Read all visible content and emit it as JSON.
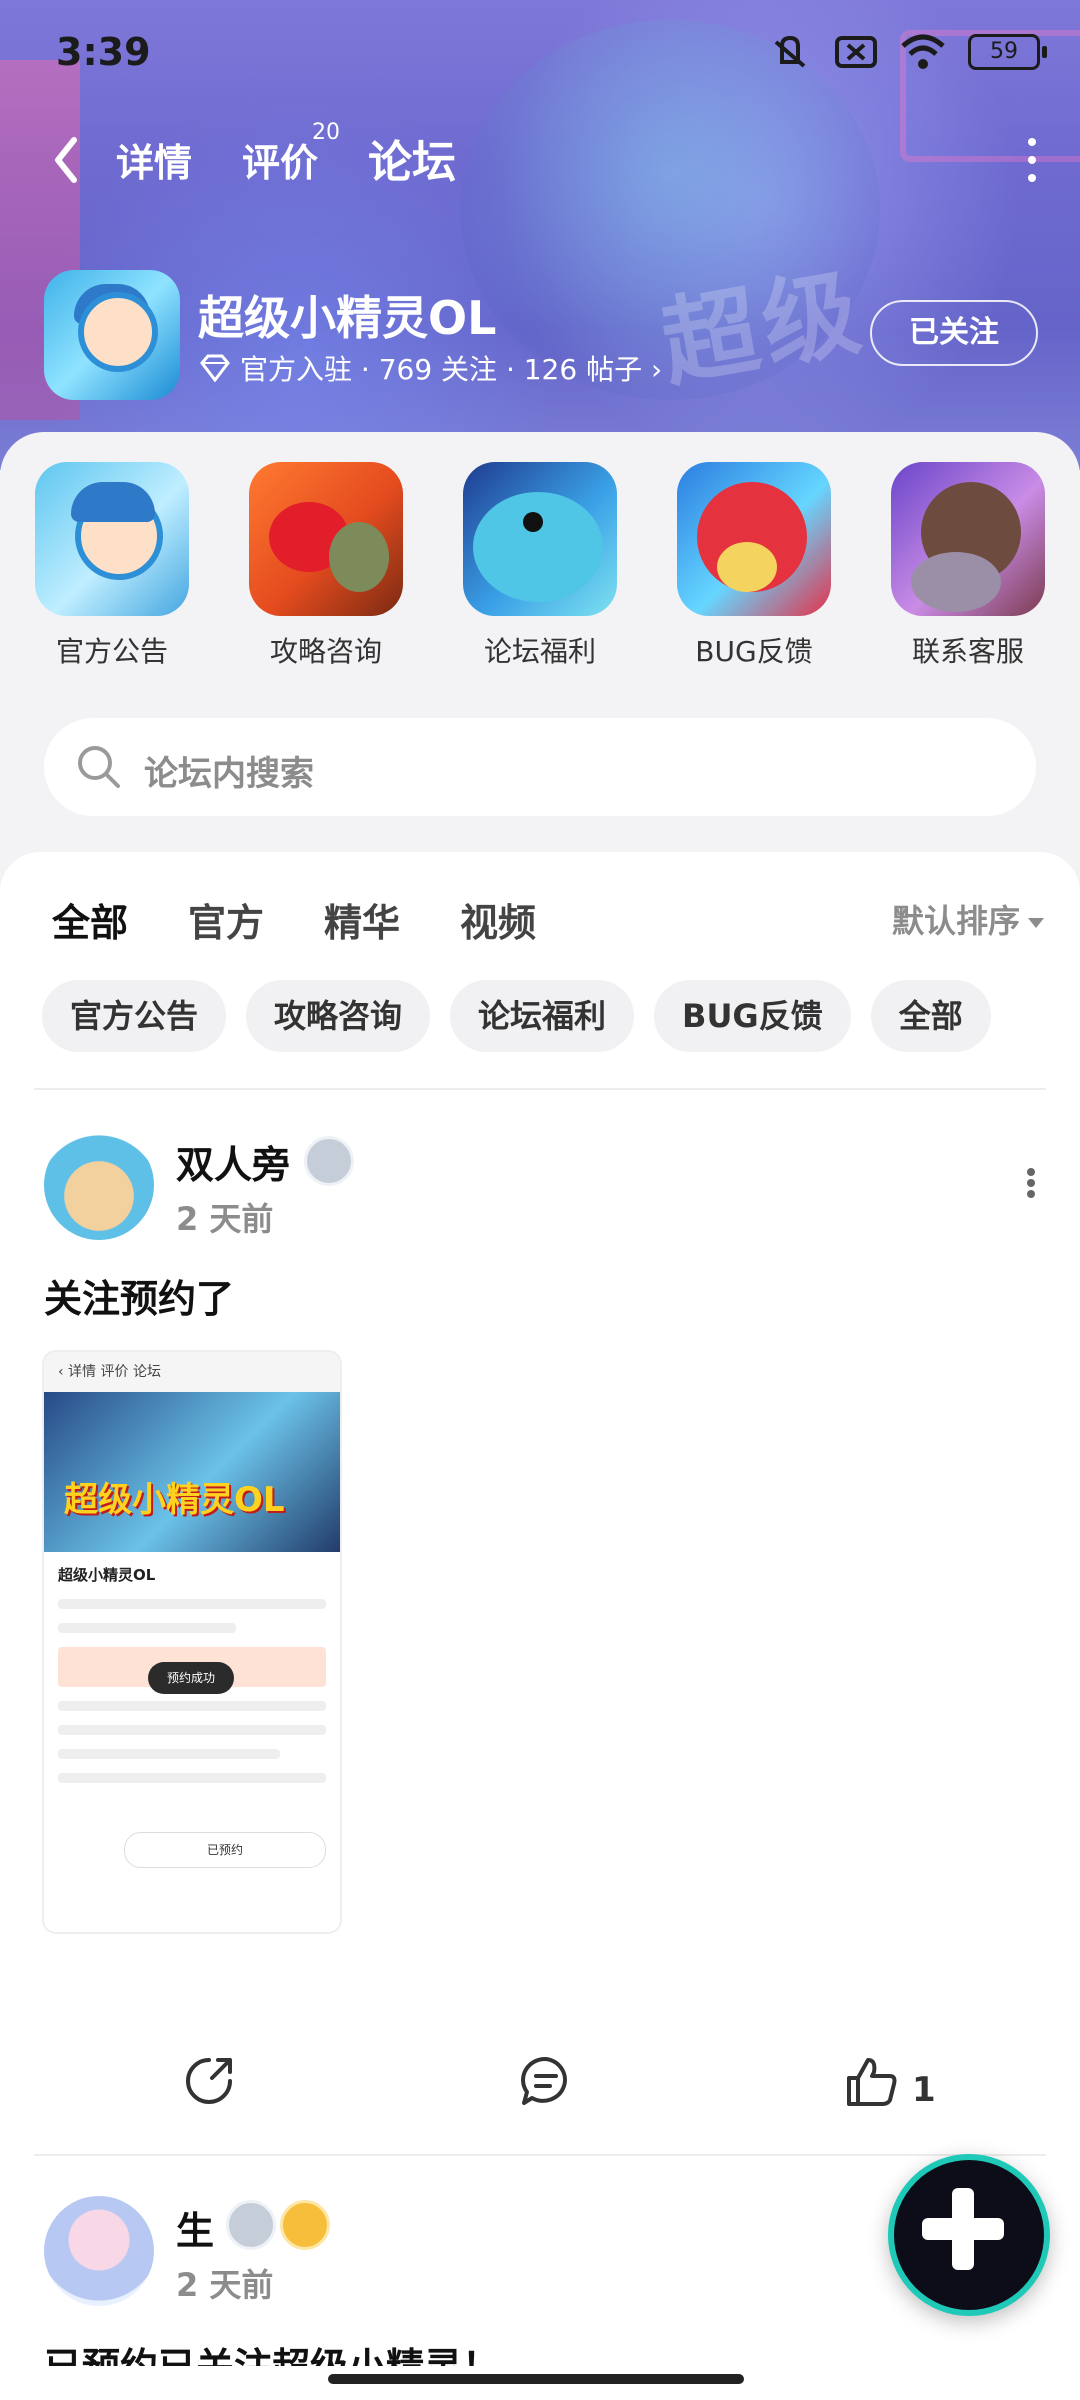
{
  "status": {
    "time": "3:39",
    "battery": "59"
  },
  "nav": {
    "tabs": [
      {
        "label": "详情"
      },
      {
        "label": "评价"
      },
      {
        "label": "论坛"
      }
    ],
    "reviews_badge": "20"
  },
  "app": {
    "name": "超级小精灵OL",
    "meta": "官方入驻 · 769 关注 · 126 帖子 ›",
    "follow_label": "已关注"
  },
  "categories": [
    {
      "label": "官方公告"
    },
    {
      "label": "攻略咨询"
    },
    {
      "label": "论坛福利"
    },
    {
      "label": "BUG反馈"
    },
    {
      "label": "联系客服"
    }
  ],
  "search": {
    "placeholder": "论坛内搜索"
  },
  "feed": {
    "tabs": [
      "全部",
      "官方",
      "精华",
      "视频"
    ],
    "sort_label": "默认排序",
    "chips": [
      "官方公告",
      "攻略咨询",
      "论坛福利",
      "BUG反馈",
      "全部"
    ]
  },
  "posts": [
    {
      "user": "双人旁",
      "time": "2 天前",
      "text": "关注预约了",
      "likes": "1",
      "screenshot": {
        "title": "超级小精灵OL",
        "banner_text": "超级小精灵OL",
        "toast": "预约成功",
        "button": "已预约"
      }
    },
    {
      "user": "生",
      "time": "2 天前",
      "text": "已预约已关注超级小精灵！"
    }
  ],
  "colors": {
    "accent": "#27d3b4",
    "header": "#6e6ad0"
  }
}
